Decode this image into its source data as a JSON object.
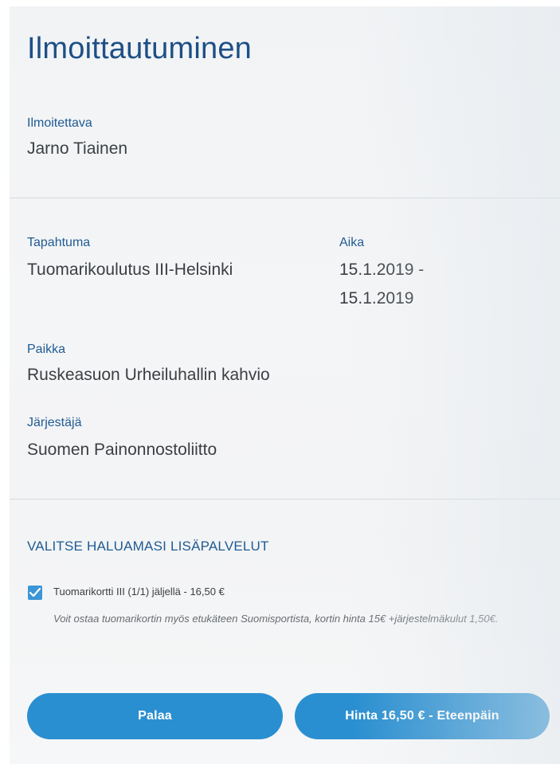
{
  "header": {
    "title": "Ilmoittautuminen"
  },
  "registrant": {
    "label": "Ilmoitettava",
    "name": "Jarno Tiainen"
  },
  "event": {
    "event_label": "Tapahtuma",
    "event_name": "Tuomarikoulutus III-Helsinki",
    "time_label": "Aika",
    "time_start": "15.1.2019 -",
    "time_end": "15.1.2019",
    "place_label": "Paikka",
    "place": "Ruskeasuon Urheiluhallin kahvio",
    "organizer_label": "Järjestäjä",
    "organizer": "Suomen Painonnostoliitto"
  },
  "extras": {
    "heading": "VALITSE HALUAMASI LISÄPALVELUT",
    "option": {
      "checked": true,
      "label": "Tuomarikortti III (1/1) jäljellä - 16,50 €",
      "note": "Voit ostaa tuomarikortin myös etukäteen Suomisportista, kortin hinta 15€ +järjestelmäkulut 1,50€."
    }
  },
  "actions": {
    "back_label": "Palaa",
    "next_label": "Hinta 16,50 € - Eteenpäin"
  },
  "colors": {
    "accent": "#2a8fd0",
    "heading": "#1d4f86",
    "label": "#1f5b93"
  }
}
